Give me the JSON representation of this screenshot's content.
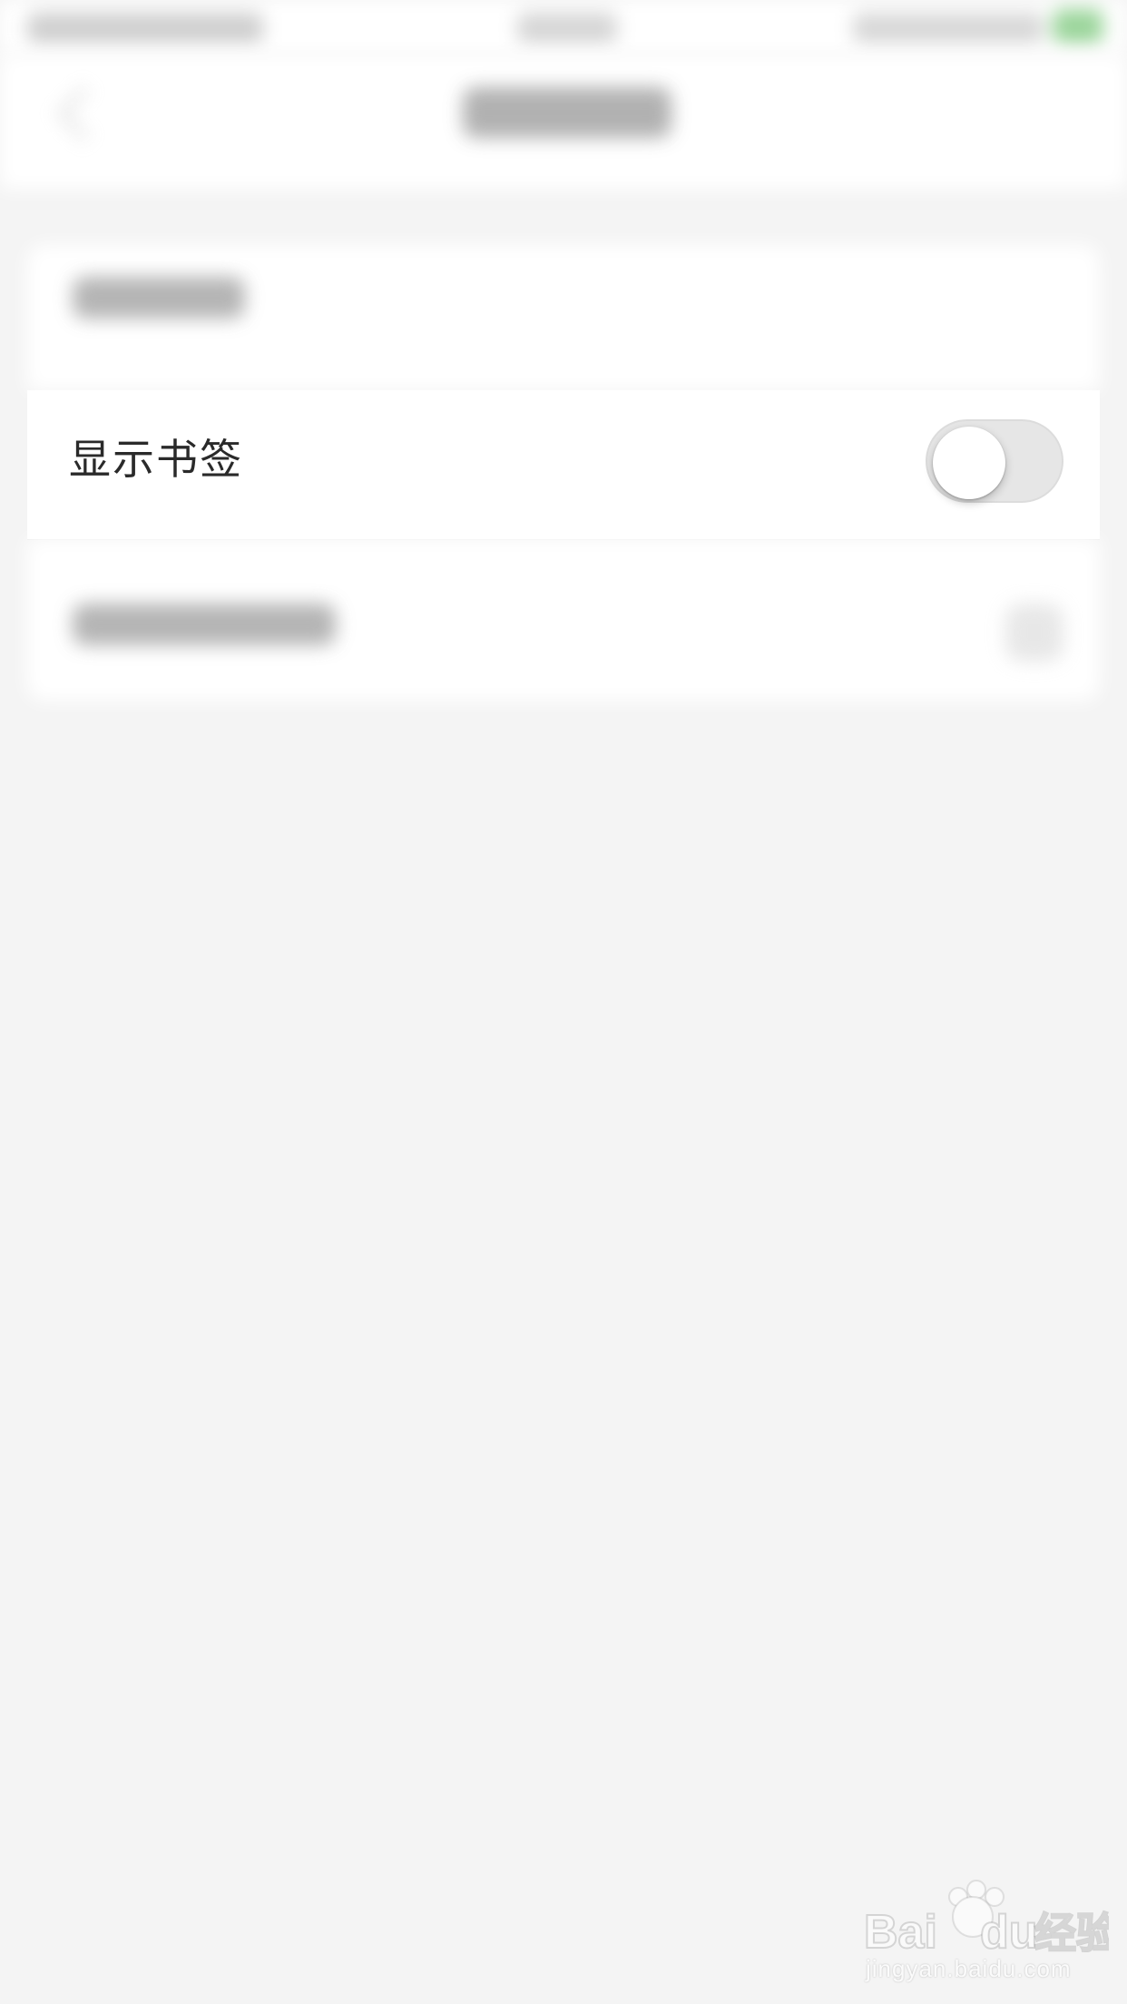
{
  "settings": {
    "rows": [
      {
        "label": "显示书签",
        "toggle": {
          "on": false
        }
      }
    ]
  },
  "watermark": {
    "brand": "Baidu经验",
    "url": "jingyan.baidu.com"
  },
  "colors": {
    "background": "#f4f4f4",
    "card": "#ffffff",
    "text": "#2a2a2a",
    "toggle_off_track": "#e6e6e6",
    "toggle_knob": "#ffffff"
  },
  "icons": {
    "back": "back-icon",
    "chevron": "chevron-right-icon"
  }
}
